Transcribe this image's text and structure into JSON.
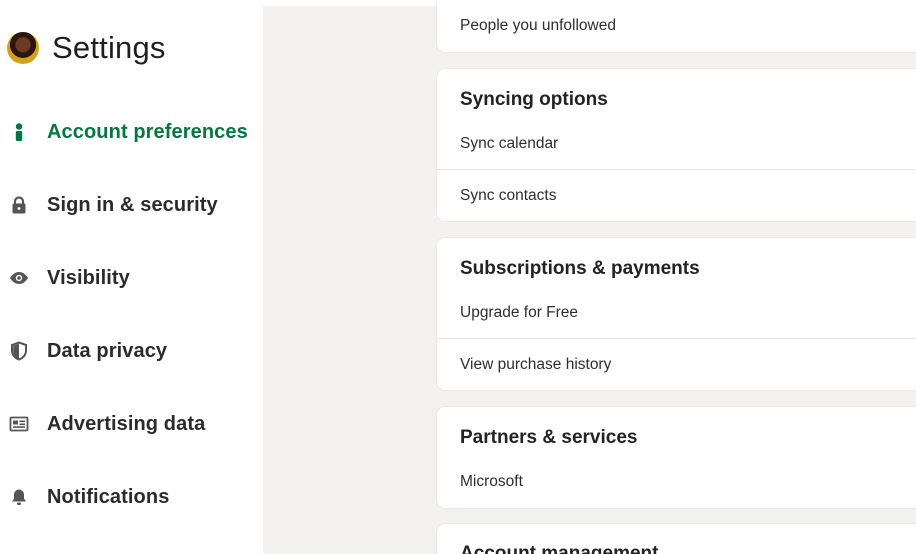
{
  "sidebar": {
    "title": "Settings",
    "items": [
      {
        "label": "Account preferences",
        "icon": "person-icon",
        "active": true
      },
      {
        "label": "Sign in & security",
        "icon": "lock-icon",
        "active": false
      },
      {
        "label": "Visibility",
        "icon": "eye-icon",
        "active": false
      },
      {
        "label": "Data privacy",
        "icon": "shield-icon",
        "active": false
      },
      {
        "label": "Advertising data",
        "icon": "newspaper-icon",
        "active": false
      },
      {
        "label": "Notifications",
        "icon": "bell-icon",
        "active": false
      }
    ]
  },
  "main": {
    "general": {
      "rows": [
        "People you unfollowed"
      ]
    },
    "syncing": {
      "title": "Syncing options",
      "rows": [
        "Sync calendar",
        "Sync contacts"
      ]
    },
    "subscriptions": {
      "title": "Subscriptions & payments",
      "rows": [
        "Upgrade for Free",
        "View purchase history"
      ]
    },
    "partners": {
      "title": "Partners & services",
      "rows": [
        "Microsoft"
      ]
    },
    "account_management": {
      "title": "Account management"
    }
  },
  "colors": {
    "accent": "#057642",
    "background": "#f4f2ee",
    "card": "#ffffff"
  }
}
